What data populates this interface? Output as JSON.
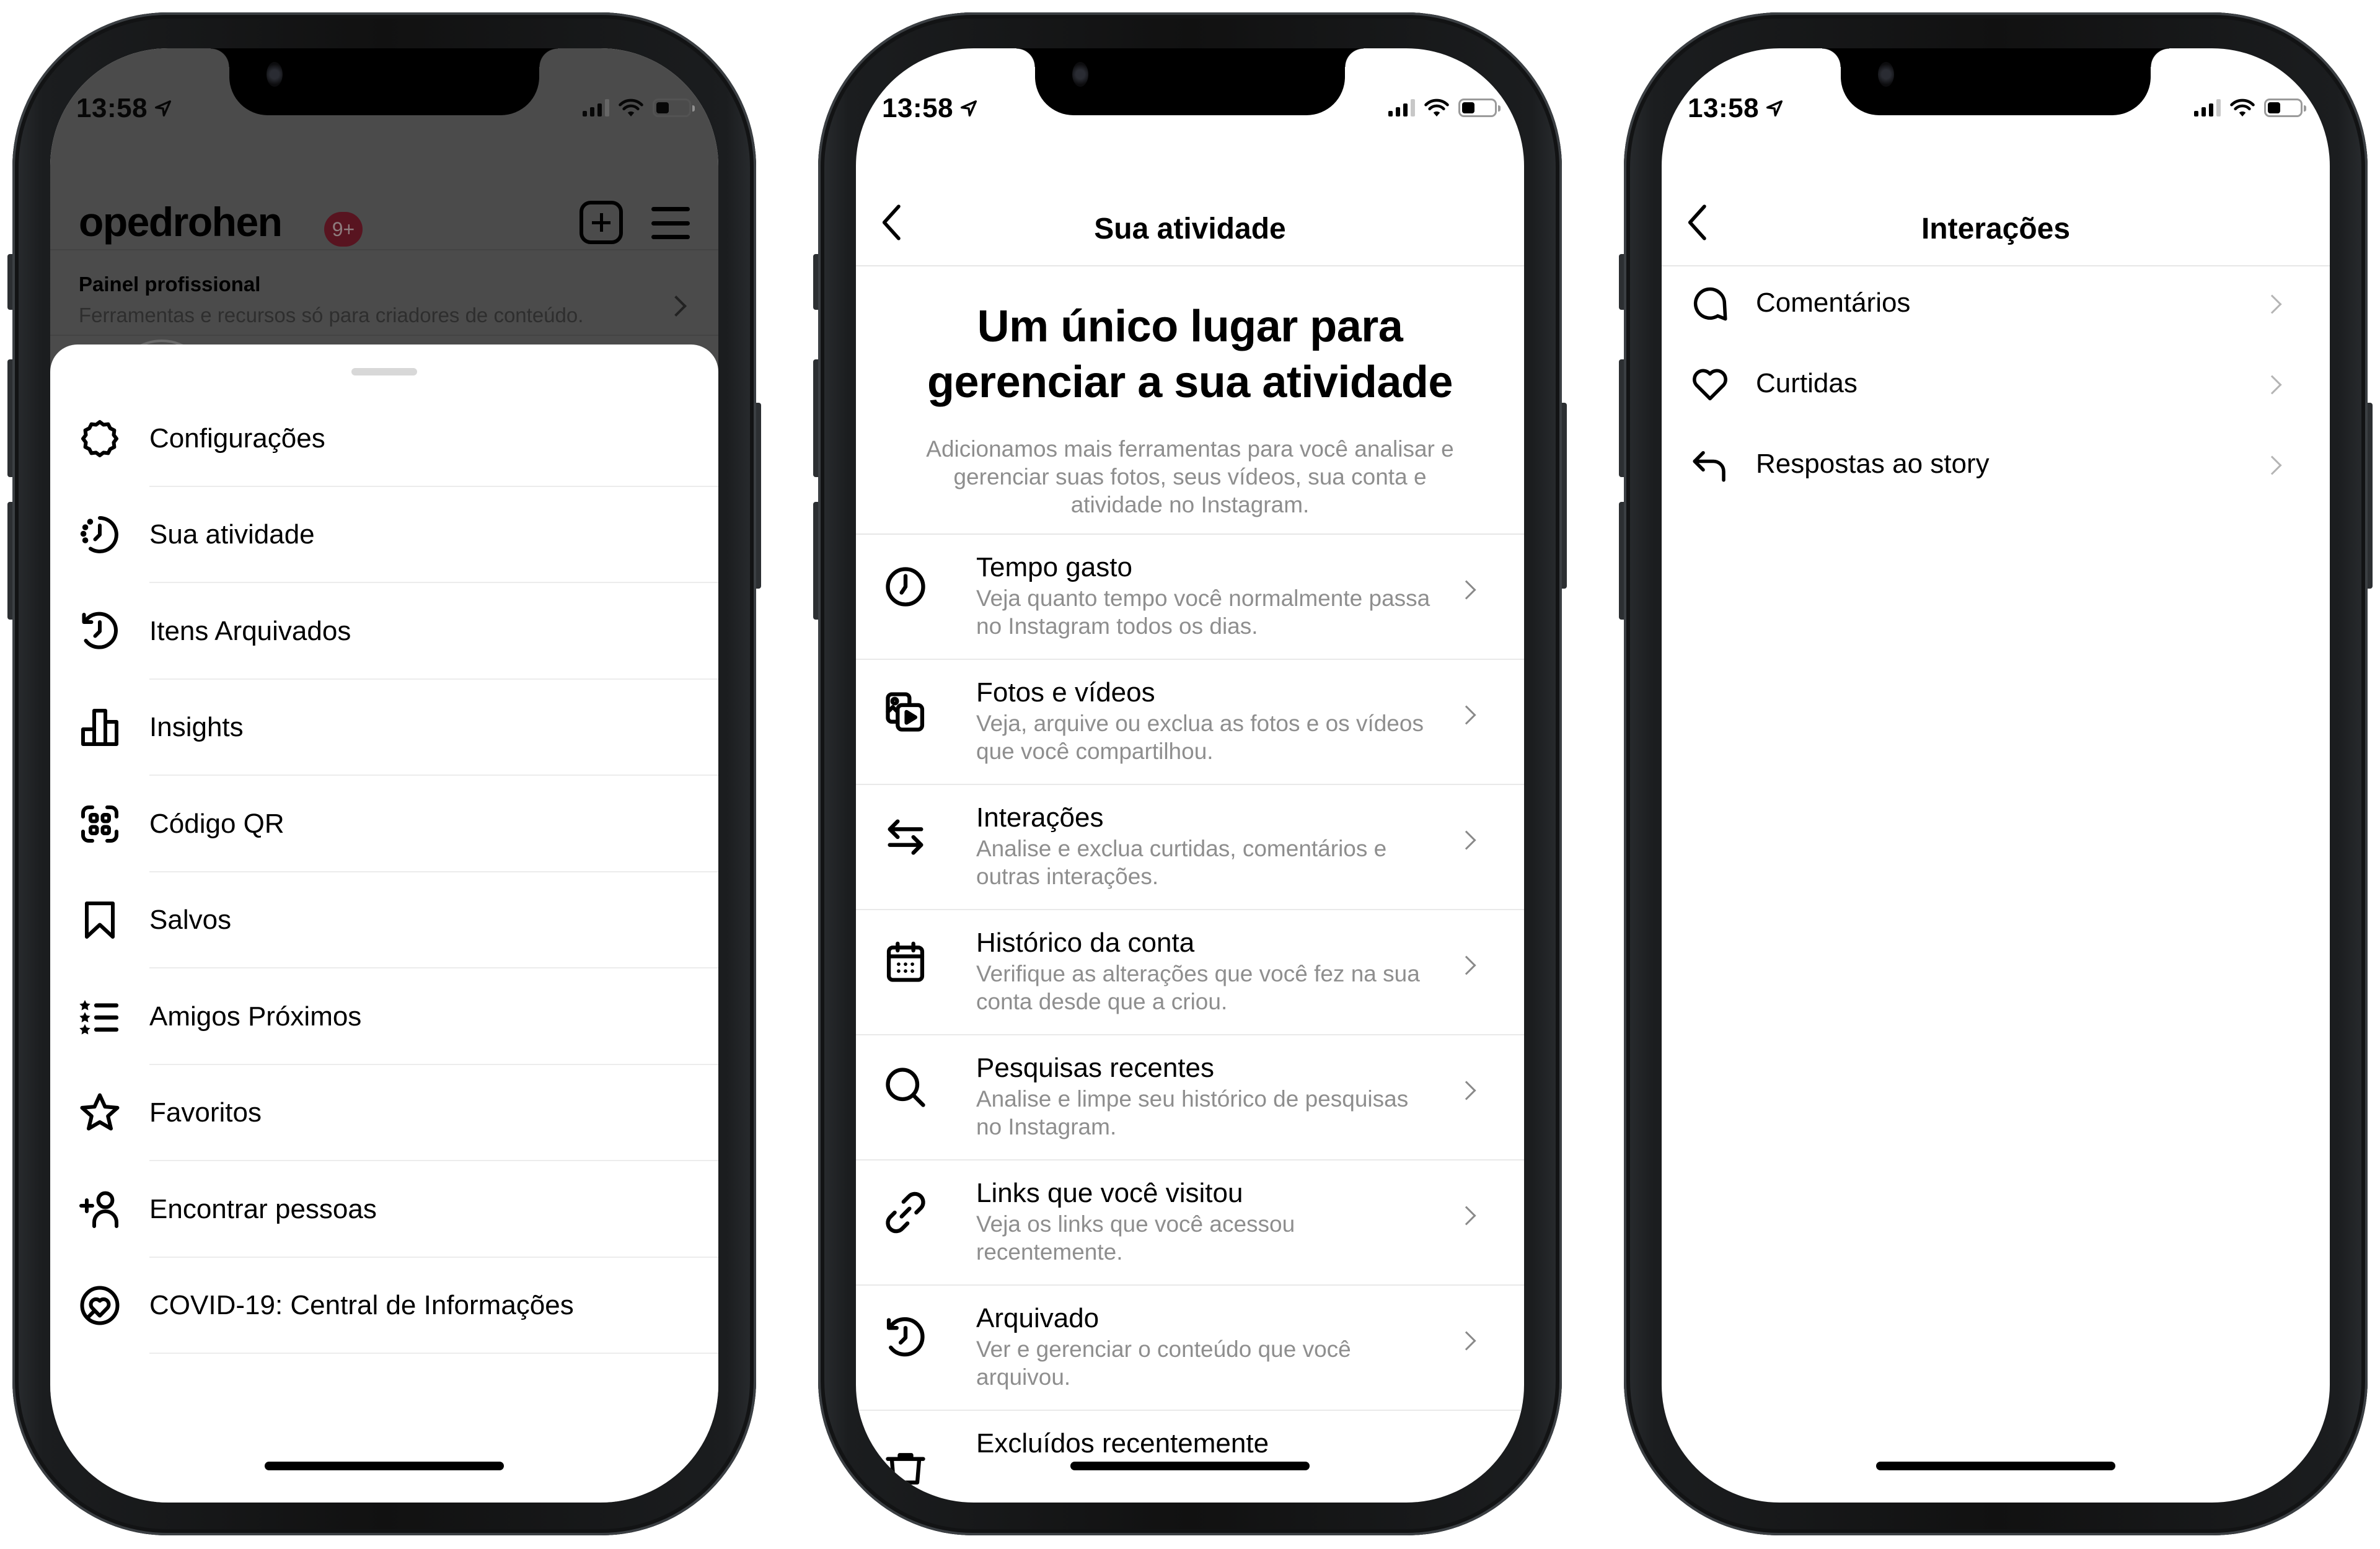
{
  "status_bar": {
    "time": "13:58",
    "location_icon": "location-arrow-icon",
    "signal_bars_active": 3,
    "signal_bars_total": 4,
    "wifi_icon": "wifi-icon",
    "battery_level": 0.4
  },
  "phone1": {
    "header": {
      "username": "opedrohen",
      "notification_badge": "9+",
      "new_post_icon": "plus-square-icon",
      "menu_icon": "hamburger-menu-icon"
    },
    "professional_panel": {
      "title": "Painel profissional",
      "subtitle": "Ferramentas e recursos só para criadores de conteúdo."
    },
    "menu_items": [
      {
        "label": "Configurações",
        "icon": "settings-gear-icon"
      },
      {
        "label": "Sua atividade",
        "icon": "activity-clock-icon"
      },
      {
        "label": "Itens Arquivados",
        "icon": "archive-history-icon"
      },
      {
        "label": "Insights",
        "icon": "bar-chart-icon"
      },
      {
        "label": "Código QR",
        "icon": "qr-code-icon"
      },
      {
        "label": "Salvos",
        "icon": "bookmark-icon"
      },
      {
        "label": "Amigos Próximos",
        "icon": "close-friends-list-icon"
      },
      {
        "label": "Favoritos",
        "icon": "star-icon"
      },
      {
        "label": "Encontrar pessoas",
        "icon": "add-person-icon"
      },
      {
        "label": "COVID-19: Central de Informações",
        "icon": "covid-heart-icon"
      }
    ]
  },
  "phone2": {
    "nav_title": "Sua atividade",
    "hero_title": "Um único lugar para gerenciar a sua atividade",
    "hero_subtitle": "Adicionamos mais ferramentas para você analisar e gerenciar suas fotos, seus vídeos, sua conta e atividade no Instagram.",
    "items": [
      {
        "title": "Tempo gasto",
        "description": "Veja quanto tempo você normalmente passa no Instagram todos os dias.",
        "icon": "clock-icon"
      },
      {
        "title": "Fotos e vídeos",
        "description": "Veja, arquive ou exclua as fotos e os vídeos que você compartilhou.",
        "icon": "photos-videos-icon"
      },
      {
        "title": "Interações",
        "description": "Analise e exclua curtidas, comentários e outras interações.",
        "icon": "arrows-exchange-icon"
      },
      {
        "title": "Histórico da conta",
        "description": "Verifique as alterações que você fez na sua conta desde que a criou.",
        "icon": "calendar-icon"
      },
      {
        "title": "Pesquisas recentes",
        "description": "Analise e limpe seu histórico de pesquisas no Instagram.",
        "icon": "search-icon"
      },
      {
        "title": "Links que você visitou",
        "description": "Veja os links que você acessou recentemente.",
        "icon": "link-icon"
      },
      {
        "title": "Arquivado",
        "description": "Ver e gerenciar o conteúdo que você arquivou.",
        "icon": "archive-history-icon"
      },
      {
        "title": "Excluídos recentemente",
        "description": "",
        "icon": "trash-icon"
      }
    ]
  },
  "phone3": {
    "nav_title": "Interações",
    "items": [
      {
        "label": "Comentários",
        "icon": "comment-bubble-icon"
      },
      {
        "label": "Curtidas",
        "icon": "heart-icon"
      },
      {
        "label": "Respostas ao story",
        "icon": "reply-arrow-icon"
      }
    ]
  },
  "colors": {
    "badge": "#581420",
    "secondary_text": "#8e8e8e",
    "separator": "#e9e9e9",
    "dim_overlay": "#4b4b4b"
  }
}
